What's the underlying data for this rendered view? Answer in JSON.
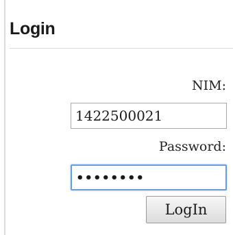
{
  "panel": {
    "title": "Login"
  },
  "form": {
    "nim_label": "NIM:",
    "nim_value": "1422500021",
    "password_label": "Password:",
    "password_value": "••••••••",
    "submit_label": "LogIn"
  },
  "colors": {
    "focus_border": "#6a9be0",
    "field_border": "#a9a9a9",
    "rule": "#d9d9d9"
  }
}
